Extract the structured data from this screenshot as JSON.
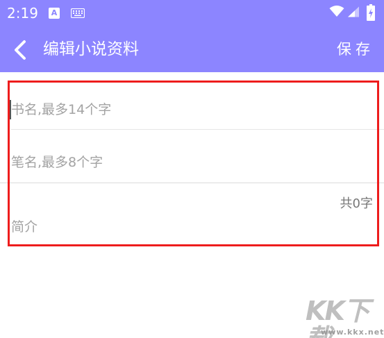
{
  "status_bar": {
    "time": "2:19",
    "notification_icon_letter": "A",
    "icons": [
      "a-notification-icon",
      "keyboard-icon",
      "wifi-icon",
      "cell-signal-icon",
      "battery-icon"
    ]
  },
  "app_bar": {
    "back_icon": "chevron-left-icon",
    "title": "编辑小说资料",
    "save_label": "保存",
    "background_color": "#8c85ff"
  },
  "form": {
    "title_placeholder": "书名,最多14个字",
    "title_value": "",
    "author_placeholder": "笔名,最多8个字",
    "author_value": "",
    "intro_counter": "共0字",
    "intro_placeholder": "简介",
    "intro_value": "",
    "highlight_color": "#ee1c1c"
  },
  "watermark": {
    "brand": "KK下载",
    "url": "www.kkx.net"
  }
}
